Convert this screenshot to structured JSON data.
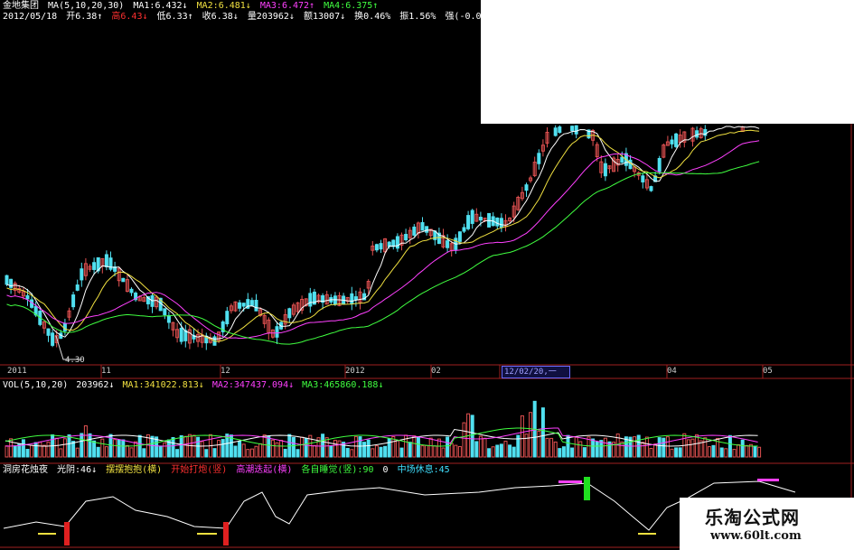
{
  "header": {
    "line1": {
      "stock_name": "金地集团",
      "ma_params": "MA(5,10,20,30)",
      "ma1": "MA1:6.432↓",
      "ma2": "MA2:6.481↓",
      "ma3": "MA3:6.472↑",
      "ma4": "MA4:6.375↑"
    },
    "line2": {
      "date": "2012/05/18",
      "open": "开6.38↑",
      "high": "高6.43↓",
      "low": "低6.33↑",
      "close": "收6.38↓",
      "volume": "量203962↓",
      "amount": "额13007↓",
      "turnover": "换0.46%",
      "amplitude": "振1.56%",
      "strength": "强(-0.0"
    }
  },
  "price_panel": {
    "low_label": "4.30"
  },
  "time_axis": {
    "labels": [
      "2011",
      "11",
      "12",
      "2012",
      "02",
      "04",
      "05"
    ],
    "selected": "12/02/20,一"
  },
  "volume_panel": {
    "params": "VOL(5,10,20)",
    "vol": "203962↓",
    "ma1": "MA1:341022.813↓",
    "ma2": "MA2:347437.094↓",
    "ma3": "MA3:465860.188↓"
  },
  "indicator_panel": {
    "name": "洞房花烛夜",
    "guangyin": "光阴:46↓",
    "i1": "摆摆抱抱(横)",
    "i2": "开始打炮(竖)",
    "i3": "高潮迭起(横)",
    "i4": "各自睡觉(竖):90",
    "i5": "0",
    "i6": "中场休息:45"
  },
  "watermark": {
    "title": "乐淘公式网",
    "url": "www.60lt.com"
  },
  "colors": {
    "background": "#000000",
    "up": "#e05050",
    "down": "#50e0f0",
    "ma5": "#ffffff",
    "ma10": "#f0e040",
    "ma20": "#ff40ff",
    "ma30": "#40ff40",
    "border": "#a02020"
  }
}
